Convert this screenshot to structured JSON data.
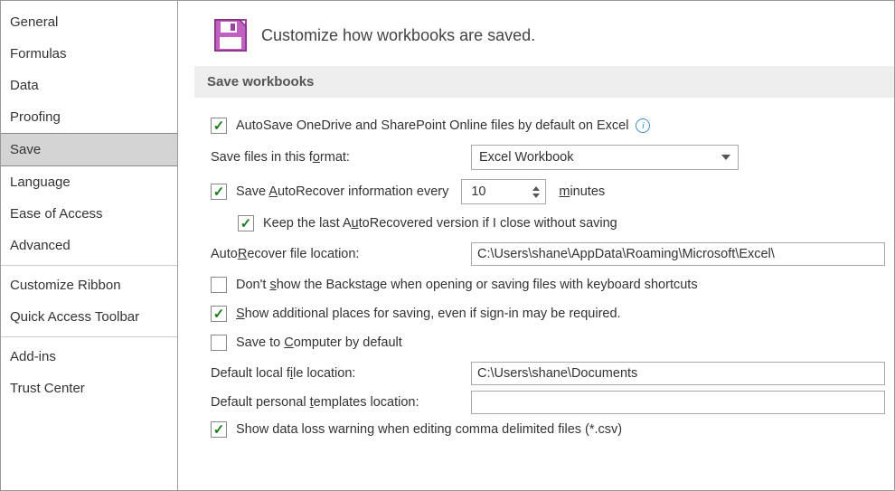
{
  "sidebar": {
    "items": [
      {
        "label": "General"
      },
      {
        "label": "Formulas"
      },
      {
        "label": "Data"
      },
      {
        "label": "Proofing"
      },
      {
        "label": "Save",
        "selected": true
      },
      {
        "label": "Language"
      },
      {
        "label": "Ease of Access"
      },
      {
        "label": "Advanced"
      },
      {
        "label": "Customize Ribbon"
      },
      {
        "label": "Quick Access Toolbar"
      },
      {
        "label": "Add-ins"
      },
      {
        "label": "Trust Center"
      }
    ]
  },
  "header": {
    "title": "Customize how workbooks are saved."
  },
  "section": {
    "title": "Save workbooks"
  },
  "opts": {
    "autosave": {
      "checked": true,
      "pre": "AutoSave OneDrive and SharePoint Online files by default on Excel"
    },
    "format": {
      "pre": "Save files in this f",
      "u": "o",
      "post": "rmat:",
      "value": "Excel Workbook"
    },
    "autorecover": {
      "checked": true,
      "pre": "Save ",
      "u": "A",
      "mid": "utoRecover information every",
      "value": "10",
      "unit_u": "m",
      "unit_post": "inutes"
    },
    "keeplast": {
      "checked": true,
      "pre": "Keep the last A",
      "u": "u",
      "post": "toRecovered version if I close without saving"
    },
    "arloc": {
      "pre": "Auto",
      "u": "R",
      "post": "ecover file location:",
      "value": "C:\\Users\\shane\\AppData\\Roaming\\Microsoft\\Excel\\"
    },
    "nobackstage": {
      "checked": false,
      "pre": "Don't ",
      "u": "s",
      "post": "how the Backstage when opening or saving files with keyboard shortcuts"
    },
    "showplaces": {
      "checked": true,
      "pre": "",
      "u": "S",
      "post": "how additional places for saving, even if sign-in may be required."
    },
    "savecomp": {
      "checked": false,
      "pre": "Save to ",
      "u": "C",
      "post": "omputer by default"
    },
    "defloc": {
      "pre": "Default local f",
      "u": "i",
      "post": "le location:",
      "value": "C:\\Users\\shane\\Documents"
    },
    "tmplloc": {
      "pre": "Default personal ",
      "u": "t",
      "post": "emplates location:",
      "value": ""
    },
    "csvwarn": {
      "checked": true,
      "label": "Show data loss warning when editing comma delimited files (*.csv)"
    }
  }
}
